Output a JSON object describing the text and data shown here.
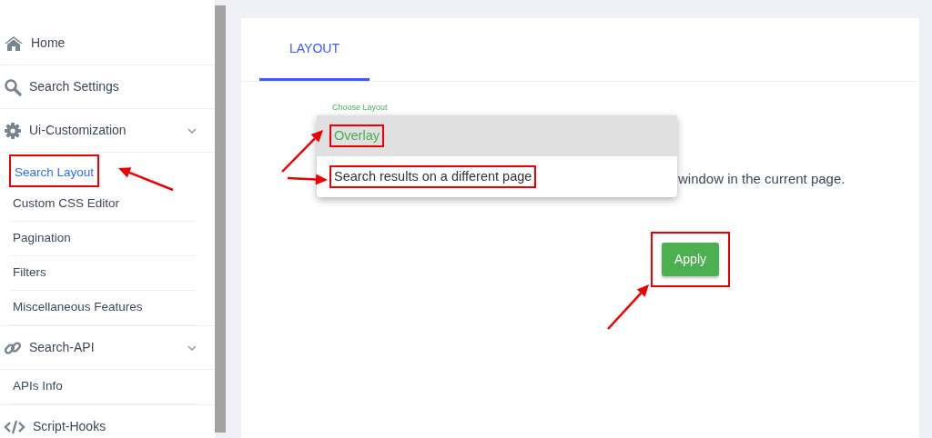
{
  "sidebar": {
    "items": [
      {
        "kind": "home",
        "label": "Home"
      },
      {
        "kind": "search",
        "label": "Search Settings"
      },
      {
        "kind": "gear",
        "label": "Ui-Customization",
        "expanded": true,
        "children": [
          {
            "label": "Search Layout",
            "selected": true,
            "highlighted": true
          },
          {
            "label": "Custom CSS Editor",
            "selected": false,
            "highlighted": false
          },
          {
            "label": "Pagination",
            "selected": false,
            "highlighted": false
          },
          {
            "label": "Filters",
            "selected": false,
            "highlighted": false
          },
          {
            "label": "Miscellaneous Features",
            "selected": false,
            "highlighted": false
          }
        ]
      },
      {
        "kind": "link",
        "label": "Search-API",
        "expanded": true,
        "children": [
          {
            "label": "APIs Info",
            "selected": false,
            "highlighted": false
          }
        ]
      },
      {
        "kind": "code",
        "label": "Script-Hooks"
      }
    ]
  },
  "tabs": [
    {
      "label": "LAYOUT",
      "selected": true
    }
  ],
  "layout_select": {
    "label": "Choose Layout",
    "options": [
      {
        "label": "Overlay",
        "selected": true,
        "highlighted": true
      },
      {
        "label": "Search results on a different page",
        "selected": false,
        "highlighted": true
      }
    ]
  },
  "description": "window in the current page.",
  "apply_button": {
    "label": "Apply",
    "highlighted": true
  }
}
